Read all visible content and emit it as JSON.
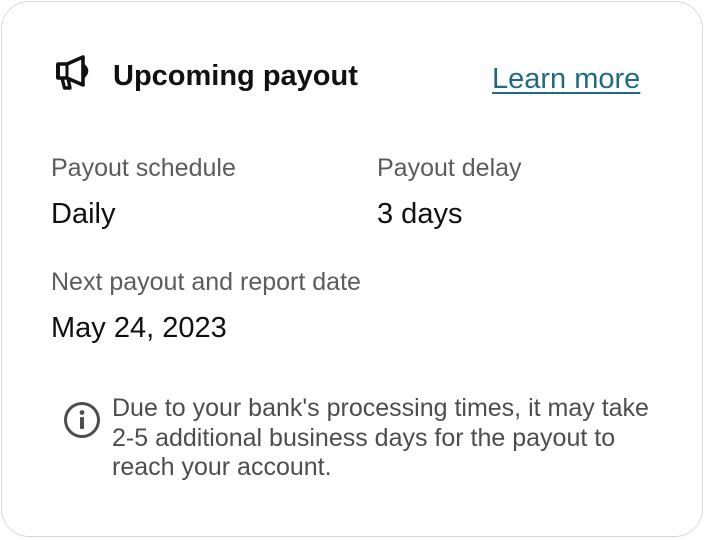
{
  "header": {
    "icon": "megaphone-icon",
    "title": "Upcoming payout",
    "learn_more": "Learn more"
  },
  "details": {
    "payout_schedule_label": "Payout schedule",
    "payout_schedule_value": "Daily",
    "payout_delay_label": "Payout delay",
    "payout_delay_value": "3 days",
    "next_payout_label": "Next payout and report date",
    "next_payout_value": "May 24, 2023"
  },
  "notice": {
    "icon": "info-icon",
    "text": "Due to your bank's processing times, it may take 2-5 additional business days for the payout to reach your account."
  },
  "colors": {
    "link": "#1f6b82",
    "label": "#5c5c5c",
    "text": "#111111",
    "border": "#d9d9d9"
  }
}
